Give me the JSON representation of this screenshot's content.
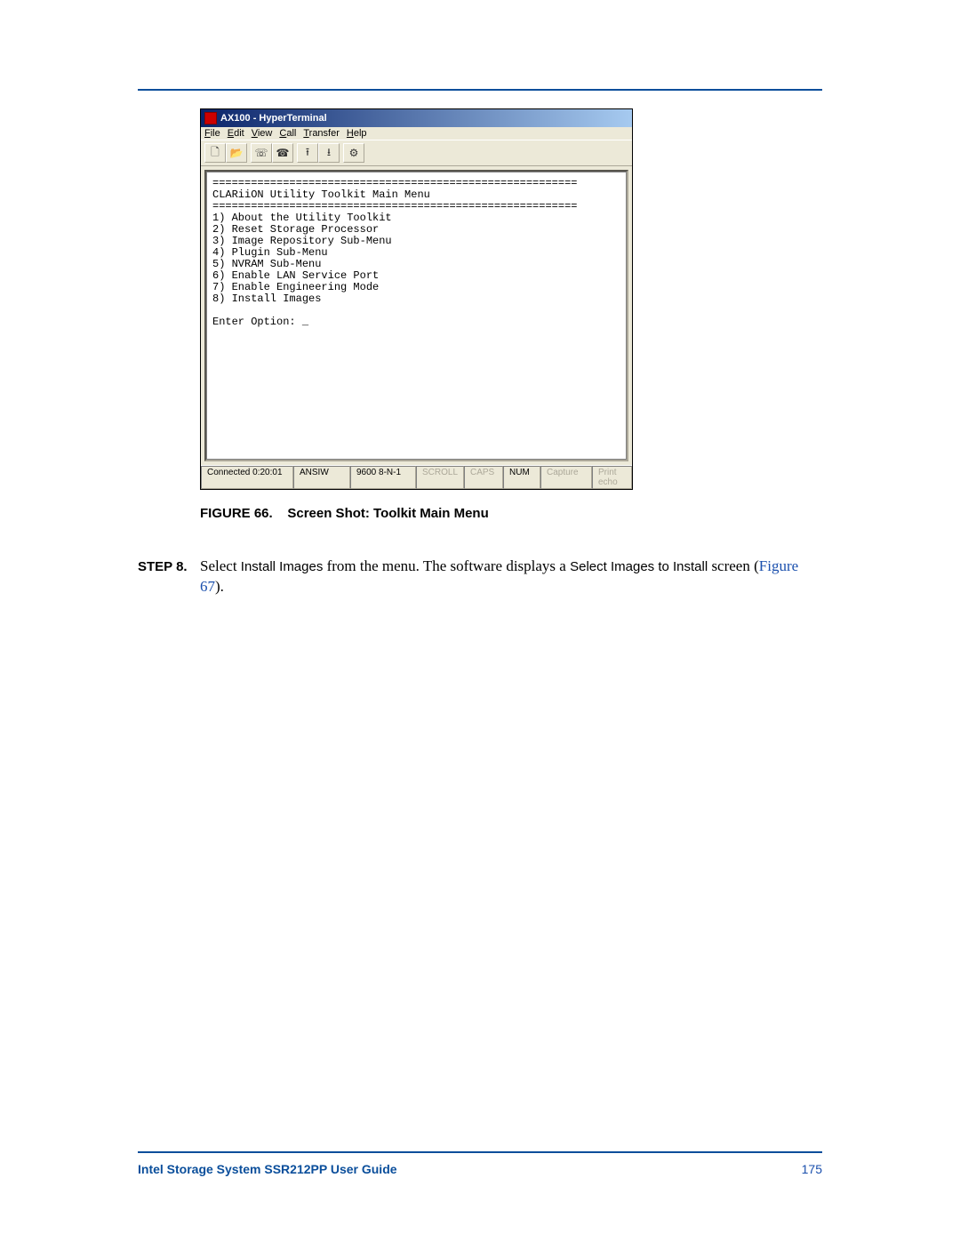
{
  "screenshot": {
    "window_title": "AX100 - HyperTerminal",
    "menus": {
      "file": "File",
      "edit": "Edit",
      "view": "View",
      "call": "Call",
      "transfer": "Transfer",
      "help": "Help"
    },
    "toolbar_icons": [
      "new-doc-icon",
      "open-folder-icon",
      "phone-icon",
      "phone-hangup-icon",
      "send-icon",
      "receive-icon",
      "properties-icon"
    ],
    "terminal_text": "=========================================================\nCLARiiON Utility Toolkit Main Menu\n=========================================================\n1) About the Utility Toolkit\n2) Reset Storage Processor\n3) Image Repository Sub-Menu\n4) Plugin Sub-Menu\n5) NVRAM Sub-Menu\n6) Enable LAN Service Port\n7) Enable Engineering Mode\n8) Install Images\n\nEnter Option: _",
    "status": {
      "connected": "Connected 0:20:01",
      "emulation": "ANSIW",
      "port": "9600 8-N-1",
      "scroll": "SCROLL",
      "caps": "CAPS",
      "num": "NUM",
      "capture": "Capture",
      "printecho": "Print echo"
    }
  },
  "caption": {
    "label": "FIGURE 66.",
    "text": "Screen Shot: Toolkit Main Menu"
  },
  "step": {
    "label": "STEP 8.",
    "pre": "Select ",
    "term1": "Install Images",
    "mid": " from the menu. The software displays a ",
    "term2": "Select Images to Install",
    "post1": " screen (",
    "xref": "Figure 67",
    "post2": ")."
  },
  "footer": {
    "title": "Intel Storage System SSR212PP User Guide",
    "page": "175"
  }
}
